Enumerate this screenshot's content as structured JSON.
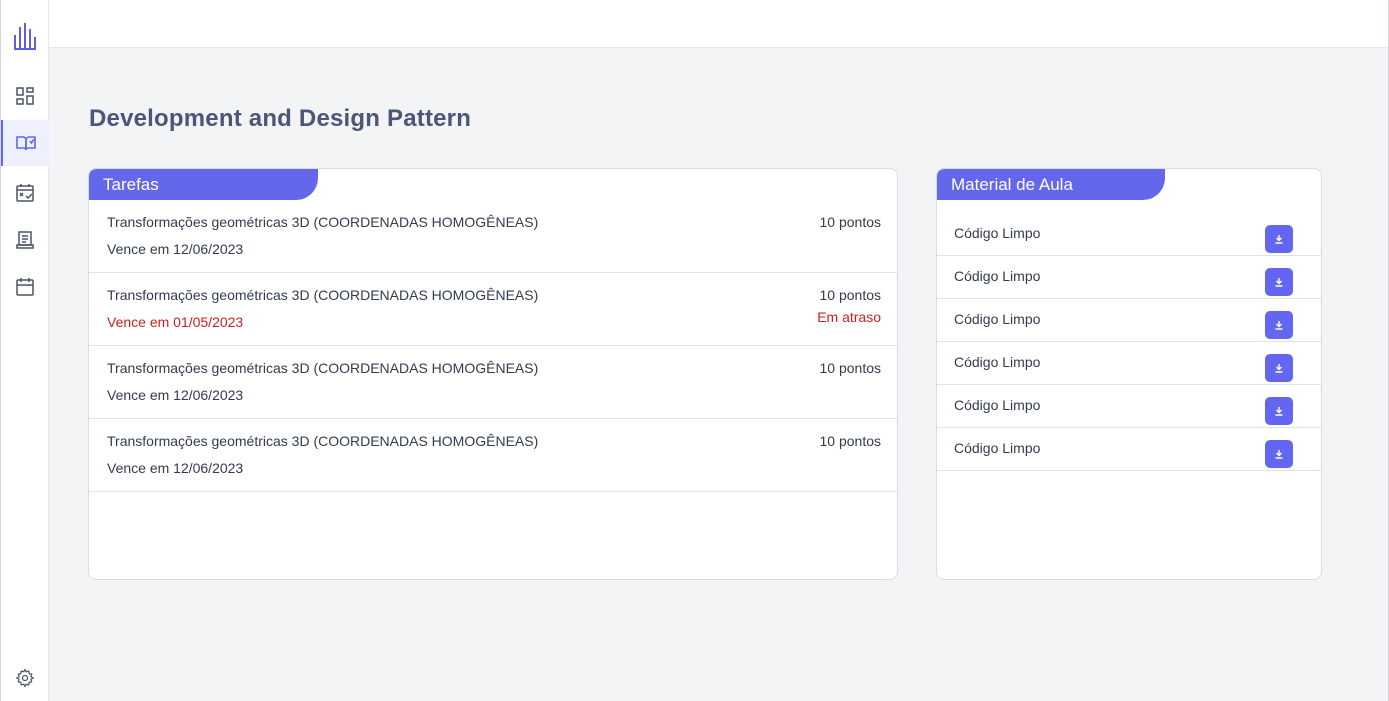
{
  "sidebar": {
    "logo_icon": "building-chart-icon",
    "items": [
      {
        "icon": "dashboard-icon",
        "active": false
      },
      {
        "icon": "book-open-icon",
        "active": true
      },
      {
        "icon": "calendar-check-icon",
        "active": false
      },
      {
        "icon": "document-list-icon",
        "active": false
      },
      {
        "icon": "calendar-icon",
        "active": false
      }
    ],
    "settings_icon": "gear-icon"
  },
  "page": {
    "title": "Development and Design Pattern"
  },
  "tasks": {
    "header": "Tarefas",
    "items": [
      {
        "title": "Transformações geométricas 3D (COORDENADAS HOMOGÊNEAS)",
        "due": "Vence em 12/06/2023",
        "points": "10 pontos",
        "status": ""
      },
      {
        "title": "Transformações geométricas 3D (COORDENADAS HOMOGÊNEAS)",
        "due": "Vence em 01/05/2023",
        "points": "10 pontos",
        "status": "Em atraso"
      },
      {
        "title": "Transformações geométricas 3D (COORDENADAS HOMOGÊNEAS)",
        "due": "Vence em 12/06/2023",
        "points": "10 pontos",
        "status": ""
      },
      {
        "title": "Transformações geométricas 3D (COORDENADAS HOMOGÊNEAS)",
        "due": "Vence em 12/06/2023",
        "points": "10 pontos",
        "status": ""
      }
    ]
  },
  "materials": {
    "header": "Material de Aula",
    "download_icon": "download-icon",
    "items": [
      {
        "label": "Código Limpo"
      },
      {
        "label": "Código Limpo"
      },
      {
        "label": "Código Limpo"
      },
      {
        "label": "Código Limpo"
      },
      {
        "label": "Código Limpo"
      },
      {
        "label": "Código Limpo"
      }
    ]
  },
  "colors": {
    "accent": "#6366f1",
    "late": "#cc1f1f",
    "title": "#4a5778"
  }
}
